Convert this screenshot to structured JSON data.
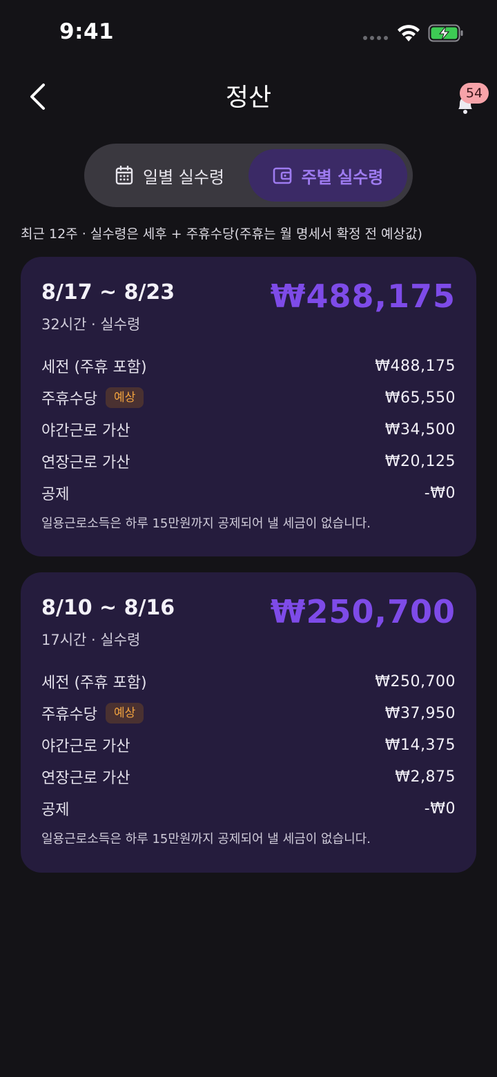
{
  "status": {
    "time": "9:41"
  },
  "header": {
    "title": "정산",
    "notification_count": "54"
  },
  "tabs": [
    {
      "label": "일별 실수령",
      "icon": "calendar-icon",
      "selected": false
    },
    {
      "label": "주별 실수령",
      "icon": "wallet-icon",
      "selected": true
    }
  ],
  "note": "최근 12주 · 실수령은 세후 + 주휴수당(주휴는 월 명세서 확정 전 예상값)",
  "weeks": [
    {
      "range": "8/17 ~ 8/23",
      "subline": "32시간 · 실수령",
      "amount": "₩488,175",
      "rows": [
        {
          "label": "세전 (주휴 포함)",
          "value": "₩488,175"
        },
        {
          "label": "주휴수당",
          "badge": "예상",
          "value": "₩65,550"
        },
        {
          "label": "야간근로 가산",
          "value": "₩34,500"
        },
        {
          "label": "연장근로 가산",
          "value": "₩20,125"
        },
        {
          "label": "공제",
          "value": "-₩0"
        }
      ],
      "footnote": "일용근로소득은 하루 15만원까지 공제되어 낼 세금이 없습니다."
    },
    {
      "range": "8/10 ~ 8/16",
      "subline": "17시간 · 실수령",
      "amount": "₩250,700",
      "rows": [
        {
          "label": "세전 (주휴 포함)",
          "value": "₩250,700"
        },
        {
          "label": "주휴수당",
          "badge": "예상",
          "value": "₩37,950"
        },
        {
          "label": "야간근로 가산",
          "value": "₩14,375"
        },
        {
          "label": "연장근로 가산",
          "value": "₩2,875"
        },
        {
          "label": "공제",
          "value": "-₩0"
        }
      ],
      "footnote": "일용근로소득은 하루 15만원까지 공제되어 낼 세금이 없습니다."
    }
  ],
  "colors": {
    "accent": "#7E4BE8",
    "card": "#251C3D",
    "badge_text": "#F2A33F",
    "notification": "#F7A3A9"
  }
}
